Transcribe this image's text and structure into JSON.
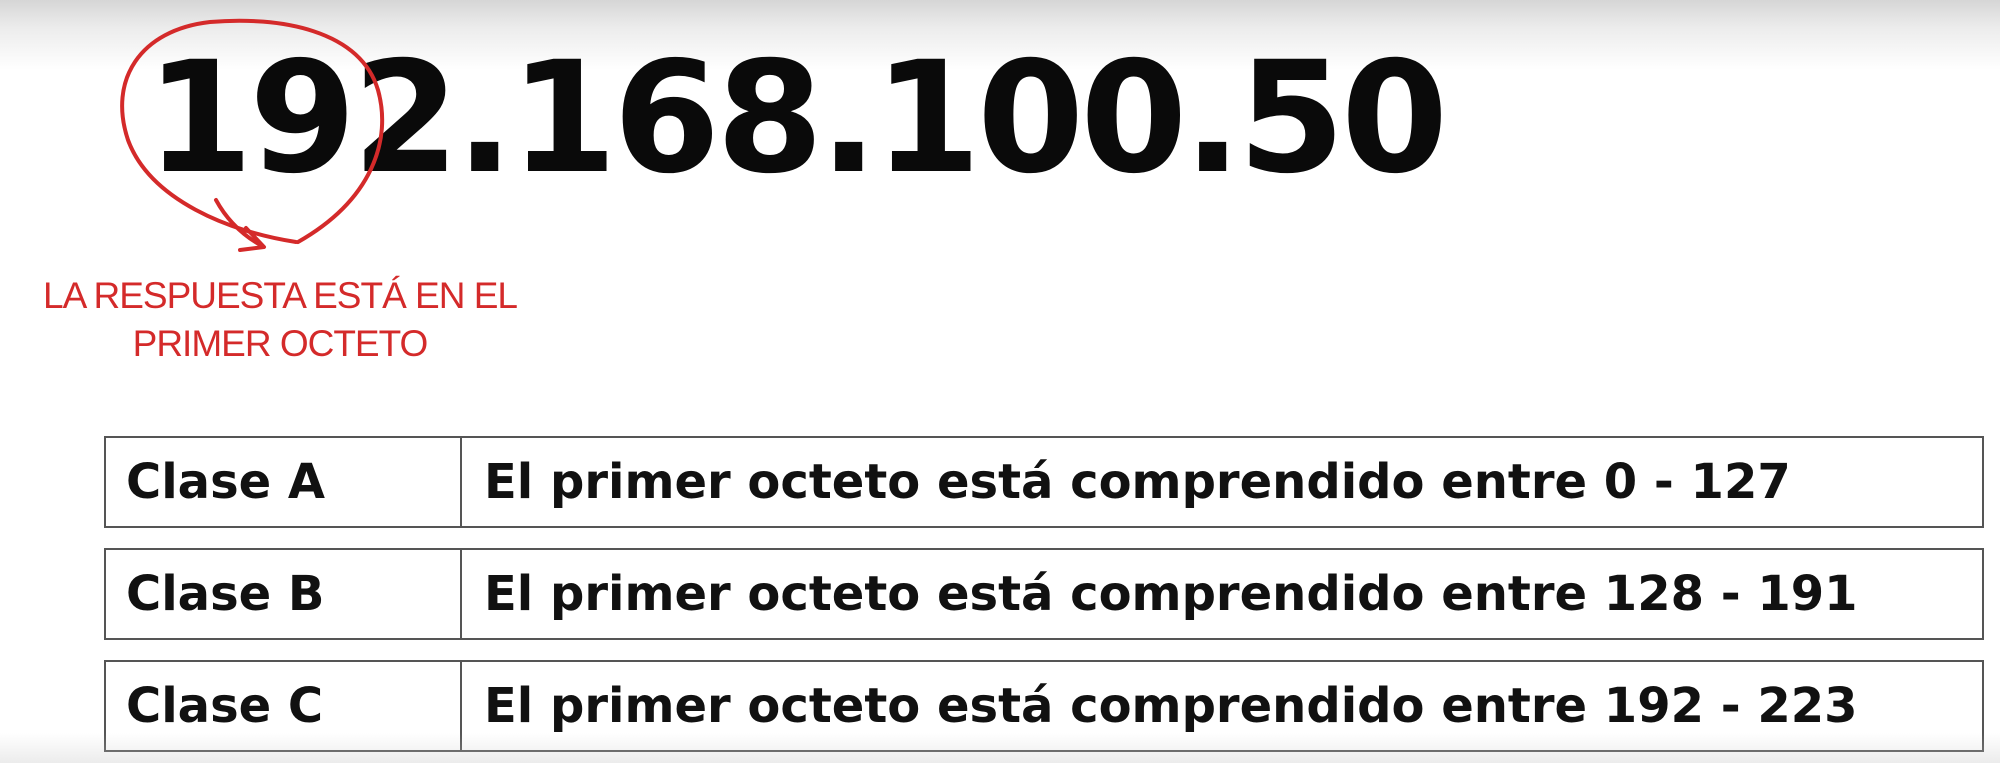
{
  "ip": {
    "address": "192.168.100.50"
  },
  "annotation": {
    "line1": "LA RESPUESTA ESTÁ EN EL",
    "line2": "PRIMER OCTETO",
    "color": "#d42a2a"
  },
  "classes": [
    {
      "name": "Clase A",
      "description": "El primer octeto está comprendido entre 0 - 127"
    },
    {
      "name": "Clase B",
      "description": "El primer octeto está comprendido entre 128 - 191"
    },
    {
      "name": "Clase C",
      "description": "El primer octeto está comprendido entre 192 - 223"
    }
  ]
}
